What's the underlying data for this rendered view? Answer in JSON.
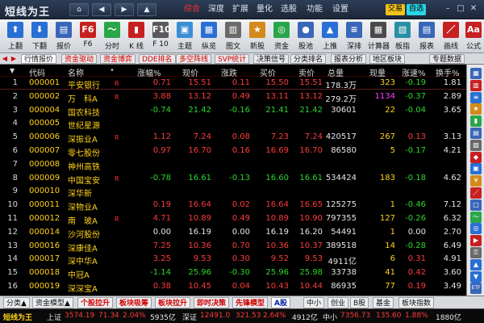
{
  "app": {
    "title": "短线为王",
    "menu": [
      "综合",
      "深度",
      "扩展",
      "量化",
      "选股",
      "功能",
      "设置"
    ],
    "active_menu": "综合",
    "badges": [
      "交易",
      "自选"
    ],
    "nav": [
      "⌂",
      "◀",
      "▶",
      "▲"
    ],
    "window_btns": [
      "–",
      "□",
      "✕"
    ]
  },
  "toolbar": [
    {
      "label": "上翻",
      "icon": "up-arrow-icon",
      "glyph": "⬆",
      "color": "#2a6fd4"
    },
    {
      "label": "下翻",
      "icon": "down-arrow-icon",
      "glyph": "⬇",
      "color": "#2a6fd4"
    },
    {
      "label": "报价",
      "icon": "quote-icon",
      "glyph": "▤",
      "color": "#3a66b8"
    },
    {
      "label": "F6",
      "icon": "f6-icon",
      "glyph": "F6",
      "color": "#c72020"
    },
    {
      "label": "分时",
      "icon": "timeline-icon",
      "glyph": "〜",
      "color": "#2aa64a"
    },
    {
      "label": "K 线",
      "icon": "kline-icon",
      "glyph": "▮",
      "color": "#c72020"
    },
    {
      "label": "F 10",
      "icon": "f10-icon",
      "glyph": "F10",
      "color": "#5a5a5a"
    },
    {
      "label": "主题",
      "icon": "theme-icon",
      "glyph": "▣",
      "color": "#3a8fd4"
    },
    {
      "label": "纵览",
      "icon": "overview-icon",
      "glyph": "▦",
      "color": "#2a6fd4"
    },
    {
      "label": "图文",
      "icon": "doc-icon",
      "glyph": "▥",
      "color": "#6a6a6a"
    },
    {
      "label": "新股",
      "icon": "new-stock-icon",
      "glyph": "★",
      "color": "#d48a1a"
    },
    {
      "label": "资金",
      "icon": "fund-icon",
      "glyph": "◎",
      "color": "#2aa64a"
    },
    {
      "label": "股池",
      "icon": "pool-icon",
      "glyph": "●",
      "color": "#3a66b8"
    },
    {
      "label": "上推",
      "icon": "push-up-icon",
      "glyph": "▲",
      "color": "#2a6fd4"
    },
    {
      "label": "深排",
      "icon": "rank-icon",
      "glyph": "≡",
      "color": "#3a66b8"
    },
    {
      "label": "计算器",
      "icon": "calculator-icon",
      "glyph": "▦",
      "color": "#4a4a4a"
    },
    {
      "label": "板指",
      "icon": "index-icon",
      "glyph": "▧",
      "color": "#2a8fa6"
    },
    {
      "label": "报表",
      "icon": "report-icon",
      "glyph": "▤",
      "color": "#3a66b8"
    },
    {
      "label": "画线",
      "icon": "draw-line-icon",
      "glyph": "／",
      "color": "#c72020"
    },
    {
      "label": "公式",
      "icon": "formula-icon",
      "glyph": "Aa",
      "color": "#c72020"
    }
  ],
  "tabs": [
    {
      "label": "行情报价",
      "hot": false,
      "sel": true
    },
    {
      "label": "资金驱动",
      "hot": true,
      "sel": false
    },
    {
      "label": "资金博弈",
      "hot": true,
      "sel": false
    },
    {
      "label": "DDE排名",
      "hot": true,
      "sel": false
    },
    {
      "label": "多空阵线",
      "hot": true,
      "sel": false
    },
    {
      "label": "SVP统计",
      "hot": true,
      "sel": false
    },
    {
      "label": "决策信号",
      "hot": false,
      "sel": false
    },
    {
      "label": "分类排名",
      "hot": false,
      "sel": false
    },
    {
      "label": "报表分析",
      "hot": false,
      "sel": false
    },
    {
      "label": "地区板块",
      "hot": false,
      "sel": false
    },
    {
      "label": "专题数据",
      "hot": false,
      "sel": false
    }
  ],
  "columns": [
    "代码",
    "名称",
    "•",
    "涨幅%",
    "现价",
    "涨跌",
    "买价",
    "卖价",
    "总量",
    "现量",
    "涨速%",
    "换手%"
  ],
  "rows": [
    {
      "idx": "1",
      "code": "000001",
      "name": "平安银行",
      "flag": "R",
      "chg_pct": "0.71",
      "price": "15.51",
      "chg": "0.11",
      "bid": "15.50",
      "ask": "15.51",
      "vol": "178.3万",
      "cur": "323",
      "speed": "-0.19",
      "turn": "1.81",
      "dir": "up"
    },
    {
      "idx": "2",
      "code": "000002",
      "name": "万　科A",
      "flag": "R",
      "chg_pct": "3.88",
      "price": "13.12",
      "chg": "0.49",
      "bid": "13.11",
      "ask": "13.12",
      "vol": "279.2万",
      "cur": "1134",
      "speed": "-0.37",
      "turn": "2.89",
      "dir": "up"
    },
    {
      "idx": "3",
      "code": "000004",
      "name": "国农科技",
      "flag": "",
      "chg_pct": "-0.74",
      "price": "21.42",
      "chg": "-0.16",
      "bid": "21.41",
      "ask": "21.42",
      "vol": "30601",
      "cur": "22",
      "speed": "-0.04",
      "turn": "3.65",
      "dir": "down"
    },
    {
      "idx": "4",
      "code": "000005",
      "name": "世纪星源",
      "flag": "",
      "chg_pct": "",
      "price": "",
      "chg": "",
      "bid": "",
      "ask": "",
      "vol": "",
      "cur": "",
      "speed": "",
      "turn": "",
      "dir": "none"
    },
    {
      "idx": "5",
      "code": "000006",
      "name": "深振业A",
      "flag": "R",
      "chg_pct": "1.12",
      "price": "7.24",
      "chg": "0.08",
      "bid": "7.23",
      "ask": "7.24",
      "vol": "420517",
      "cur": "267",
      "speed": "0.13",
      "turn": "3.13",
      "dir": "up"
    },
    {
      "idx": "6",
      "code": "000007",
      "name": "零七股份",
      "flag": "",
      "chg_pct": "0.97",
      "price": "16.70",
      "chg": "0.16",
      "bid": "16.69",
      "ask": "16.70",
      "vol": "86580",
      "cur": "5",
      "speed": "-0.17",
      "turn": "4.21",
      "dir": "up"
    },
    {
      "idx": "7",
      "code": "000008",
      "name": "神州高铁",
      "flag": "",
      "chg_pct": "",
      "price": "",
      "chg": "",
      "bid": "",
      "ask": "",
      "vol": "",
      "cur": "",
      "speed": "",
      "turn": "",
      "dir": "none"
    },
    {
      "idx": "8",
      "code": "000009",
      "name": "中国宝安",
      "flag": "R",
      "chg_pct": "-0.78",
      "price": "16.61",
      "chg": "-0.13",
      "bid": "16.60",
      "ask": "16.61",
      "vol": "534424",
      "cur": "183",
      "speed": "-0.18",
      "turn": "4.62",
      "dir": "down"
    },
    {
      "idx": "9",
      "code": "000010",
      "name": "深华新",
      "flag": "",
      "chg_pct": "",
      "price": "",
      "chg": "",
      "bid": "",
      "ask": "",
      "vol": "",
      "cur": "",
      "speed": "",
      "turn": "",
      "dir": "none"
    },
    {
      "idx": "10",
      "code": "000011",
      "name": "深物业A",
      "flag": "",
      "chg_pct": "0.19",
      "price": "16.64",
      "chg": "0.02",
      "bid": "16.64",
      "ask": "16.65",
      "vol": "125275",
      "cur": "1",
      "speed": "-0.46",
      "turn": "7.12",
      "dir": "up"
    },
    {
      "idx": "11",
      "code": "000012",
      "name": "南　玻A",
      "flag": "R",
      "chg_pct": "4.71",
      "price": "10.89",
      "chg": "0.49",
      "bid": "10.89",
      "ask": "10.90",
      "vol": "797355",
      "cur": "127",
      "speed": "-0.26",
      "turn": "6.32",
      "dir": "up"
    },
    {
      "idx": "12",
      "code": "000014",
      "name": "沙河股份",
      "flag": "",
      "chg_pct": "0.00",
      "price": "16.19",
      "chg": "0.00",
      "bid": "16.19",
      "ask": "16.20",
      "vol": "54491",
      "cur": "1",
      "speed": "0.00",
      "turn": "2.70",
      "dir": "flat"
    },
    {
      "idx": "13",
      "code": "000016",
      "name": "深康佳A",
      "flag": "",
      "chg_pct": "7.25",
      "price": "10.36",
      "chg": "0.70",
      "bid": "10.36",
      "ask": "10.37",
      "vol": "389518",
      "cur": "14",
      "speed": "-0.28",
      "turn": "6.49",
      "dir": "up"
    },
    {
      "idx": "14",
      "code": "000017",
      "name": "深中华A",
      "flag": "",
      "chg_pct": "3.25",
      "price": "9.53",
      "chg": "0.30",
      "bid": "9.52",
      "ask": "9.53",
      "vol": "4911亿",
      "cur": "6",
      "speed": "0.31",
      "turn": "4.91",
      "dir": "up"
    },
    {
      "idx": "15",
      "code": "000018",
      "name": "中冠A",
      "flag": "",
      "chg_pct": "-1.14",
      "price": "25.96",
      "chg": "-0.30",
      "bid": "25.96",
      "ask": "25.98",
      "vol": "33738",
      "cur": "41",
      "speed": "0.42",
      "turn": "3.60",
      "dir": "down"
    },
    {
      "idx": "16",
      "code": "000019",
      "name": "深深宝A",
      "flag": "",
      "chg_pct": "0.38",
      "price": "10.45",
      "chg": "0.04",
      "bid": "10.43",
      "ask": "10.44",
      "vol": "86935",
      "cur": "77",
      "speed": "0.19",
      "turn": "3.49",
      "dir": "up"
    }
  ],
  "sidebar_icons": [
    {
      "icon": "grid-icon",
      "glyph": "▦",
      "color": "#3a66b8"
    },
    {
      "icon": "chart-icon",
      "glyph": "▥",
      "color": "#c72020"
    },
    {
      "icon": "list-icon",
      "glyph": "≡",
      "color": "#2a6fd4"
    },
    {
      "icon": "star-icon",
      "glyph": "★",
      "color": "#d48a1a"
    },
    {
      "icon": "bar-icon",
      "glyph": "▮",
      "color": "#2aa64a"
    },
    {
      "icon": "table-icon",
      "glyph": "▤",
      "color": "#3a66b8"
    },
    {
      "icon": "doc-icon",
      "glyph": "▧",
      "color": "#6a6a6a"
    },
    {
      "icon": "tag-icon",
      "glyph": "◆",
      "color": "#c72020"
    },
    {
      "icon": "calendar-icon",
      "glyph": "▣",
      "color": "#2a6fd4"
    },
    {
      "icon": "money-icon",
      "glyph": "¥",
      "color": "#d48a1a"
    },
    {
      "icon": "pen-icon",
      "glyph": "／",
      "color": "#c72020"
    },
    {
      "icon": "box-icon",
      "glyph": "▢",
      "color": "#3a66b8"
    },
    {
      "icon": "line-icon",
      "glyph": "〜",
      "color": "#2aa64a"
    },
    {
      "icon": "shield-icon",
      "glyph": "◎",
      "color": "#2a6fd4"
    },
    {
      "icon": "flag-icon",
      "glyph": "▶",
      "color": "#c72020"
    },
    {
      "icon": "key-icon",
      "glyph": "⚿",
      "color": "#6a6a6a"
    },
    {
      "icon": "up-icon",
      "glyph": "▲",
      "color": "#2a6fd4"
    },
    {
      "icon": "down-icon",
      "glyph": "▼",
      "color": "#2a6fd4"
    },
    {
      "icon": "exit-icon",
      "glyph": "ETF",
      "color": "#3a66b8"
    }
  ],
  "bottom_tabs": [
    {
      "label": "分类▲",
      "hot": false,
      "sel": false
    },
    {
      "label": "资金模型▲",
      "hot": false,
      "sel": false
    },
    {
      "label": "个股拉升",
      "hot": true,
      "sel": false
    },
    {
      "label": "板块吸筹",
      "hot": true,
      "sel": false
    },
    {
      "label": "板块拉升",
      "hot": true,
      "sel": false
    },
    {
      "label": "即时决策",
      "hot": true,
      "sel": false
    },
    {
      "label": "先锋模型",
      "hot": true,
      "sel": false
    },
    {
      "label": "A股",
      "hot": false,
      "sel": true
    },
    {
      "label": "中小",
      "hot": false,
      "sel": false
    },
    {
      "label": "创业",
      "hot": false,
      "sel": false
    },
    {
      "label": "B股",
      "hot": false,
      "sel": false
    },
    {
      "label": "基金",
      "hot": false,
      "sel": false
    },
    {
      "label": "板块指数",
      "hot": false,
      "sel": false
    }
  ],
  "status": {
    "brand": "短线为王",
    "sh_label": "上证",
    "sh_index": "3574.19",
    "sh_chg": "71.34",
    "sh_pct": "2.04%",
    "sh_amt": "5935亿",
    "sz_label": "深证",
    "sz_index": "12491.0",
    "sz_chg": "321.53",
    "sz_pct": "2.64%",
    "sz_amt": "4912亿",
    "zx_label": "中小",
    "zx_index": "7356.73",
    "zx_chg": "135.60",
    "zx_pct": "1.88%",
    "zx_amt": "1880亿"
  }
}
